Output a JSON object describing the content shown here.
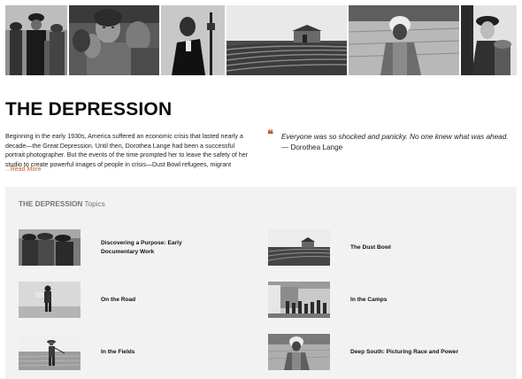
{
  "header": {
    "title": "THE DEPRESSION"
  },
  "intro": {
    "text": "Beginning in the early 1930s, America suffered an economic crisis that lasted nearly a decade—the Great Depression. Until then, Dorothea Lange had been a successful portrait photographer. But the events of the time prompted her to leave the safety of her studio to create powerful images of people in crisis—Dust Bowl refugees, migrant workers, and the urban homeless. Through her photographs, La",
    "read_more": "...Read More"
  },
  "quote": {
    "icon": "quote-icon",
    "text": "Everyone was so shocked and panicky. No one knew what was ahead.",
    "attribution": " — Dorothea Lange"
  },
  "topics": {
    "heading_bold": "THE DEPRESSION",
    "heading_rest": " Topics",
    "items": [
      {
        "label": "Discovering a Purpose: Early Documentary Work"
      },
      {
        "label": "The Dust Bowl"
      },
      {
        "label": "On the Road"
      },
      {
        "label": "In the Camps"
      },
      {
        "label": "In the Fields"
      },
      {
        "label": "Deep South: Picturing Race and Power"
      }
    ]
  },
  "colors": {
    "accent": "#c4592b",
    "panel_bg": "#f2f2f2"
  }
}
